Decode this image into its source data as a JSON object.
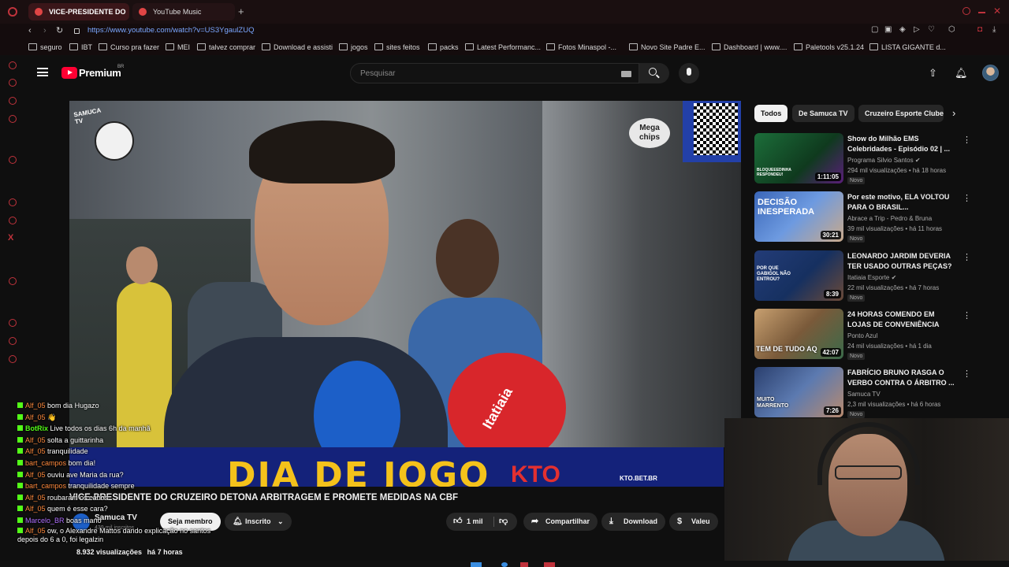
{
  "browser": {
    "tabs": [
      {
        "title": "VICE-PRESIDENTE DO",
        "active": true
      },
      {
        "title": "YouTube Music",
        "active": false
      }
    ],
    "url": "https://www.youtube.com/watch?v=US3YgaulZUQ",
    "bookmarks": [
      "seguro",
      "IBT",
      "Curso pra fazer",
      "MEI",
      "talvez comprar",
      "Download e assisti",
      "jogos",
      "sites feitos",
      "packs",
      "Latest Performanc...",
      "Fotos Minaspol -...",
      "Novo Site Padre E...",
      "Dashboard | www....",
      "Paletools v25.1.24",
      "LISTA GIGANTE d..."
    ]
  },
  "youtube": {
    "logo": "Premium",
    "region": "BR",
    "search_placeholder": "Pesquisar"
  },
  "video": {
    "overlay_logo": "SAMUCA TV",
    "sponsor": "Mega chips",
    "banner_text": "DIA DE JOGO",
    "banner_brand": "KTO",
    "banner_url": "KTO.BET.BR",
    "reporter_mic": "Itatiaia",
    "title": "VICE-PRESIDENTE DO CRUZEIRO DETONA ARBITRAGEM E PROMETE MEDIDAS NA CBF",
    "channel": "Samuca TV",
    "subscribers": "439 mil inscritos",
    "join_label": "Seja membro",
    "subscribed_label": "Inscrito",
    "likes": "1 mil",
    "share_label": "Compartilhar",
    "download_label": "Download",
    "thanks_label": "Valeu",
    "views": "8.932 visualizações",
    "age": "há 7 horas"
  },
  "chips": [
    "Todos",
    "De Samuca TV",
    "Cruzeiro Esporte Clube"
  ],
  "recommendations": [
    {
      "title": "Show do Milhão EMS Celebridades - Episódio 02 | ...",
      "channel": "Programa Silvio Santos",
      "verified": true,
      "views": "294 mil visualizações",
      "age": "há 18 horas",
      "badge": "Novo",
      "duration": "1:11:05",
      "thumb_text": "BLOQUEEEDINHA RESPONDEU!",
      "color": "#1c6e3a"
    },
    {
      "title": "Por este motivo, ELA VOLTOU PARA O BRASIL...",
      "channel": "Abrace a Trip - Pedro & Bruna",
      "verified": false,
      "views": "39 mil visualizações",
      "age": "há 11 horas",
      "badge": "Novo",
      "duration": "30:21",
      "thumb_text": "DECISÃO INESPERADA",
      "color": "#3a66b8"
    },
    {
      "title": "LEONARDO JARDIM DEVERIA TER USADO OUTRAS PEÇAS? ...",
      "channel": "Itatiaia Esporte",
      "verified": true,
      "views": "22 mil visualizações",
      "age": "há 7 horas",
      "badge": "Novo",
      "duration": "8:39",
      "thumb_text": "POR QUE GABIGOL NÃO ENTROU?",
      "color": "#233c78"
    },
    {
      "title": "24 HORAS COMENDO EM LOJAS DE CONVENIÊNCIA NO...",
      "channel": "Ponto Azul",
      "verified": false,
      "views": "24 mil visualizações",
      "age": "há 1 dia",
      "badge": "Novo",
      "duration": "42:07",
      "thumb_text": "TEM DE TUDO AQ",
      "color": "#7a5a3a"
    },
    {
      "title": "FABRÍCIO BRUNO RASGA O VERBO CONTRA O ÁRBITRO ...",
      "channel": "Samuca TV",
      "verified": false,
      "views": "2,3 mil visualizações",
      "age": "há 6 horas",
      "badge": "Novo",
      "duration": "7:26",
      "thumb_text": "MUITO MARRENTO",
      "color": "#2a3f6e"
    }
  ],
  "chat": [
    {
      "user": "Alf_05",
      "text": "bom dia Hugazo"
    },
    {
      "user": "Alf_05",
      "text": "👋"
    },
    {
      "user": "BotRix",
      "text": "Live todos os dias 6h da manhã"
    },
    {
      "user": "Alf_05",
      "text": "solta a guittarinha"
    },
    {
      "user": "Alf_05",
      "text": "tranquilidade"
    },
    {
      "user": "bart_campos",
      "text": "bom dia!"
    },
    {
      "user": "Alf_05",
      "text": "ouviu ave Maria da rua?"
    },
    {
      "user": "bart_campos",
      "text": "tranquilidade sempre"
    },
    {
      "user": "Alf_05",
      "text": "roubaram os cabos"
    },
    {
      "user": "Alf_05",
      "text": "quem é esse cara?"
    },
    {
      "user": "Marcelo_BR",
      "text": "boas mano"
    },
    {
      "user": "Alf_05",
      "text": "ow, o Alexandre Mattos dando explicação no santos depois do 6 a 0, foi legalzin"
    }
  ],
  "colors": {
    "accent": "#ff0033",
    "background": "#0f0f0f",
    "chat_badge": "#53fc18",
    "chat_user": "#ff8a3d",
    "banner": "#14227a"
  }
}
